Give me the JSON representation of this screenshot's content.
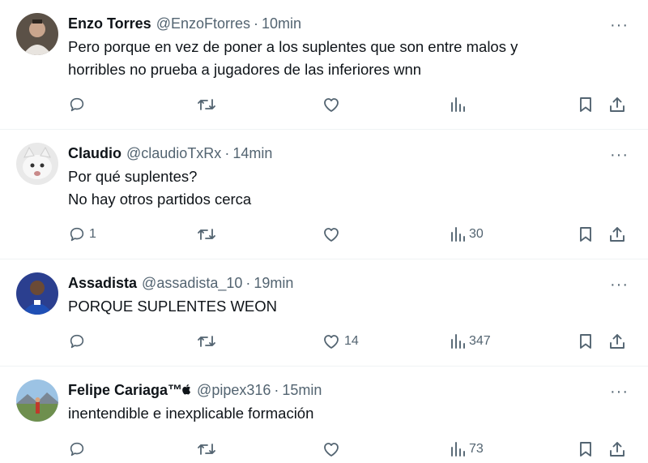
{
  "tweets": [
    {
      "name": "Enzo Torres",
      "handle": "@EnzoFtorres",
      "separator": "·",
      "time": "10min",
      "lines": [
        "Pero porque en vez de poner a los suplentes que son entre malos y",
        "horribles no prueba a jugadores de las inferiores wnn"
      ],
      "replies": "",
      "reposts": "",
      "likes": "",
      "views": "",
      "more": "···",
      "avatar_color": "#4a4a4a"
    },
    {
      "name": "Claudio",
      "handle": "@claudioTxRx",
      "separator": "·",
      "time": "14min",
      "lines": [
        "Por qué suplentes?",
        "No hay otros partidos cerca"
      ],
      "replies": "1",
      "reposts": "",
      "likes": "",
      "views": "30",
      "more": "···",
      "avatar_color": "#dcdcdc"
    },
    {
      "name": "Assadista",
      "handle": "@assadista_10",
      "separator": "·",
      "time": "19min",
      "lines": [
        "PORQUE SUPLENTES WEON"
      ],
      "replies": "",
      "reposts": "",
      "likes": "14",
      "views": "347",
      "more": "···",
      "avatar_color": "#1d3a8a"
    },
    {
      "name": "Felipe Cariaga™",
      "handle": "@pipex316",
      "separator": "·",
      "time": "15min",
      "lines": [
        "inentendible e inexplicable formación"
      ],
      "replies": "",
      "reposts": "",
      "likes": "",
      "views": "73",
      "more": "···",
      "avatar_color": "#8fb7d9"
    }
  ],
  "icons": {
    "reply": "reply-icon",
    "repost": "repost-icon",
    "like": "heart-icon",
    "views": "views-icon",
    "bookmark": "bookmark-icon",
    "share": "share-icon",
    "more": "more-icon",
    "apple": "apple-icon"
  },
  "colors": {
    "text": "#0f1419",
    "secondary": "#536471",
    "divider": "#eff3f4"
  }
}
